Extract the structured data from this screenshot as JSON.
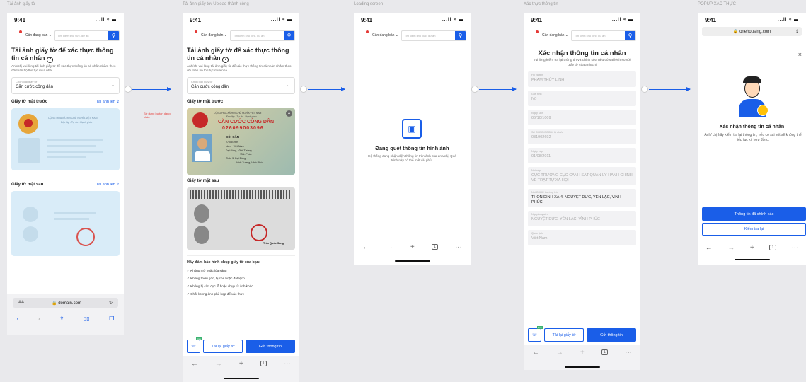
{
  "frames": {
    "f1": "Tải ảnh giấy tờ",
    "f2": "Tải ảnh giấy tờ/ Upload thành công",
    "f3": "Loading screen",
    "f4": "Xác thực thông tin",
    "f5": "POPUP XÁC THỰC"
  },
  "status": {
    "time": "9:41",
    "icons": "...ll ≈ ▬"
  },
  "header": {
    "select": "Cần đang bán",
    "search_placeholder": "Tìm kiếm khu vực, dự án"
  },
  "upload": {
    "title": "Tải ảnh giấy tờ để xác thực thông tin cá nhân",
    "help": "?",
    "desc": "Anh/chị vui lòng tải ảnh giấy tờ để xác thực thông tin cá nhân nhằm theo dõi toàn bộ thủ tục mua nhà",
    "doc_label": "Chọn loại giấy tờ",
    "doc_value": "Căn cước công dân",
    "front": "Giấy tờ mặt trước",
    "back": "Giấy tờ mặt sau",
    "upload_link": "Tải ảnh lên",
    "card_header": "CỘNG HÒA XÃ HỘI CHỦ NGHĨA VIỆT NAM",
    "card_sub": "Độc lập - Tự do - Hạnh phúc",
    "annotation": "Sử dụng button dạng plain"
  },
  "browser": {
    "aa": "AA",
    "domain": "domain.com",
    "reload": "↻"
  },
  "idcard": {
    "header": "CỘNG HÒA XÃ HỘI CHỦ NGHĨA VIỆT NAM",
    "motto": "Độc lập - Tự do - Hạnh phúc",
    "title": "CĂN CƯỚC CÔNG DÂN",
    "number": "026099003096",
    "name": "ĐỖI CẨN",
    "dob": "27/05/1999",
    "sex": "Nam",
    "nationality": "Việt Nam",
    "origin": "Đạt Đồng, Vĩnh Tường",
    "region": "Vĩnh Phúc",
    "residence": "Thôn 5, Đại Đồng",
    "residence2": "Vĩnh Tường, Vĩnh Phúc",
    "signer": "Trần Quốc Sáng"
  },
  "tips": {
    "heading": "Hãy đảm bảo hình chụp giấy tờ của bạn:",
    "items": [
      "✓ Không mờ hoặc lóa sáng",
      "✓ Không thiếu góc, bị che hoặc đặt lệch",
      "✓ Không bị cắt, đục lỗ hoặc chụp từ ảnh khác",
      "✓ Chất lượng ảnh phù hợp để xác thực"
    ]
  },
  "actions": {
    "retake": "Tải lại giấy tờ",
    "submit": "Gửi thông tin",
    "badge": "Free"
  },
  "loading": {
    "title": "Đang quét thông tin hình ảnh",
    "desc": "Hệ thống đang nhận diện thông tin trên ảnh của anh/chị. Quá trình này có thể mất vài phút."
  },
  "verify": {
    "title": "Xác nhận thông tin cá nhân",
    "desc": "Vui lòng kiểm tra lại thông tin và chỉnh sửa nếu có sai lệch so với giấy tờ của anh/chị",
    "fields": [
      {
        "label": "Họ và tên",
        "value": "PHẠM THÙY LINH"
      },
      {
        "label": "Giới tính",
        "value": "Nữ"
      },
      {
        "label": "Ngày sinh",
        "value": "06/10/1009"
      },
      {
        "label": "Số CMND/CCCD/Hộ chiếu",
        "value": "031902692"
      },
      {
        "label": "Ngày cấp",
        "value": "01/08/2011"
      },
      {
        "label": "Nơi cấp",
        "value": "CỤC TRƯỞNG CỤC CẢNH SÁT QUẢN LÝ HÀNH CHÍNH VỀ TRẬT TỰ XÃ HỘI"
      },
      {
        "label": "Nơi ĐKHK thường trú",
        "value": "THÔN ĐÌNH XÁ 4, NGUYỆT ĐỨC, YÊN LẠC, VĨNH PHÚC"
      },
      {
        "label": "Nguyên quán",
        "value": "NGUYỆT ĐỨC, YÊN LẠC, VĨNH PHÚC"
      },
      {
        "label": "Quốc tịch",
        "value": "Việt Nam"
      }
    ]
  },
  "popup": {
    "domain": "onehousing.com",
    "close": "×",
    "title": "Xác nhận thông tin cá nhân",
    "desc": "Anh/ chị hãy kiểm tra lại thông tin, nếu có sai sót sẽ không thể tiếp tục ký hợp đồng.",
    "confirm": "Thông tin đã chính xác",
    "recheck": "Kiểm tra lại"
  },
  "nav": {
    "back": "←",
    "fwd": "→",
    "plus": "+",
    "tabs": "1",
    "more": "···"
  },
  "colors": {
    "primary": "#1a5ee8",
    "annotation": "#e53935"
  }
}
